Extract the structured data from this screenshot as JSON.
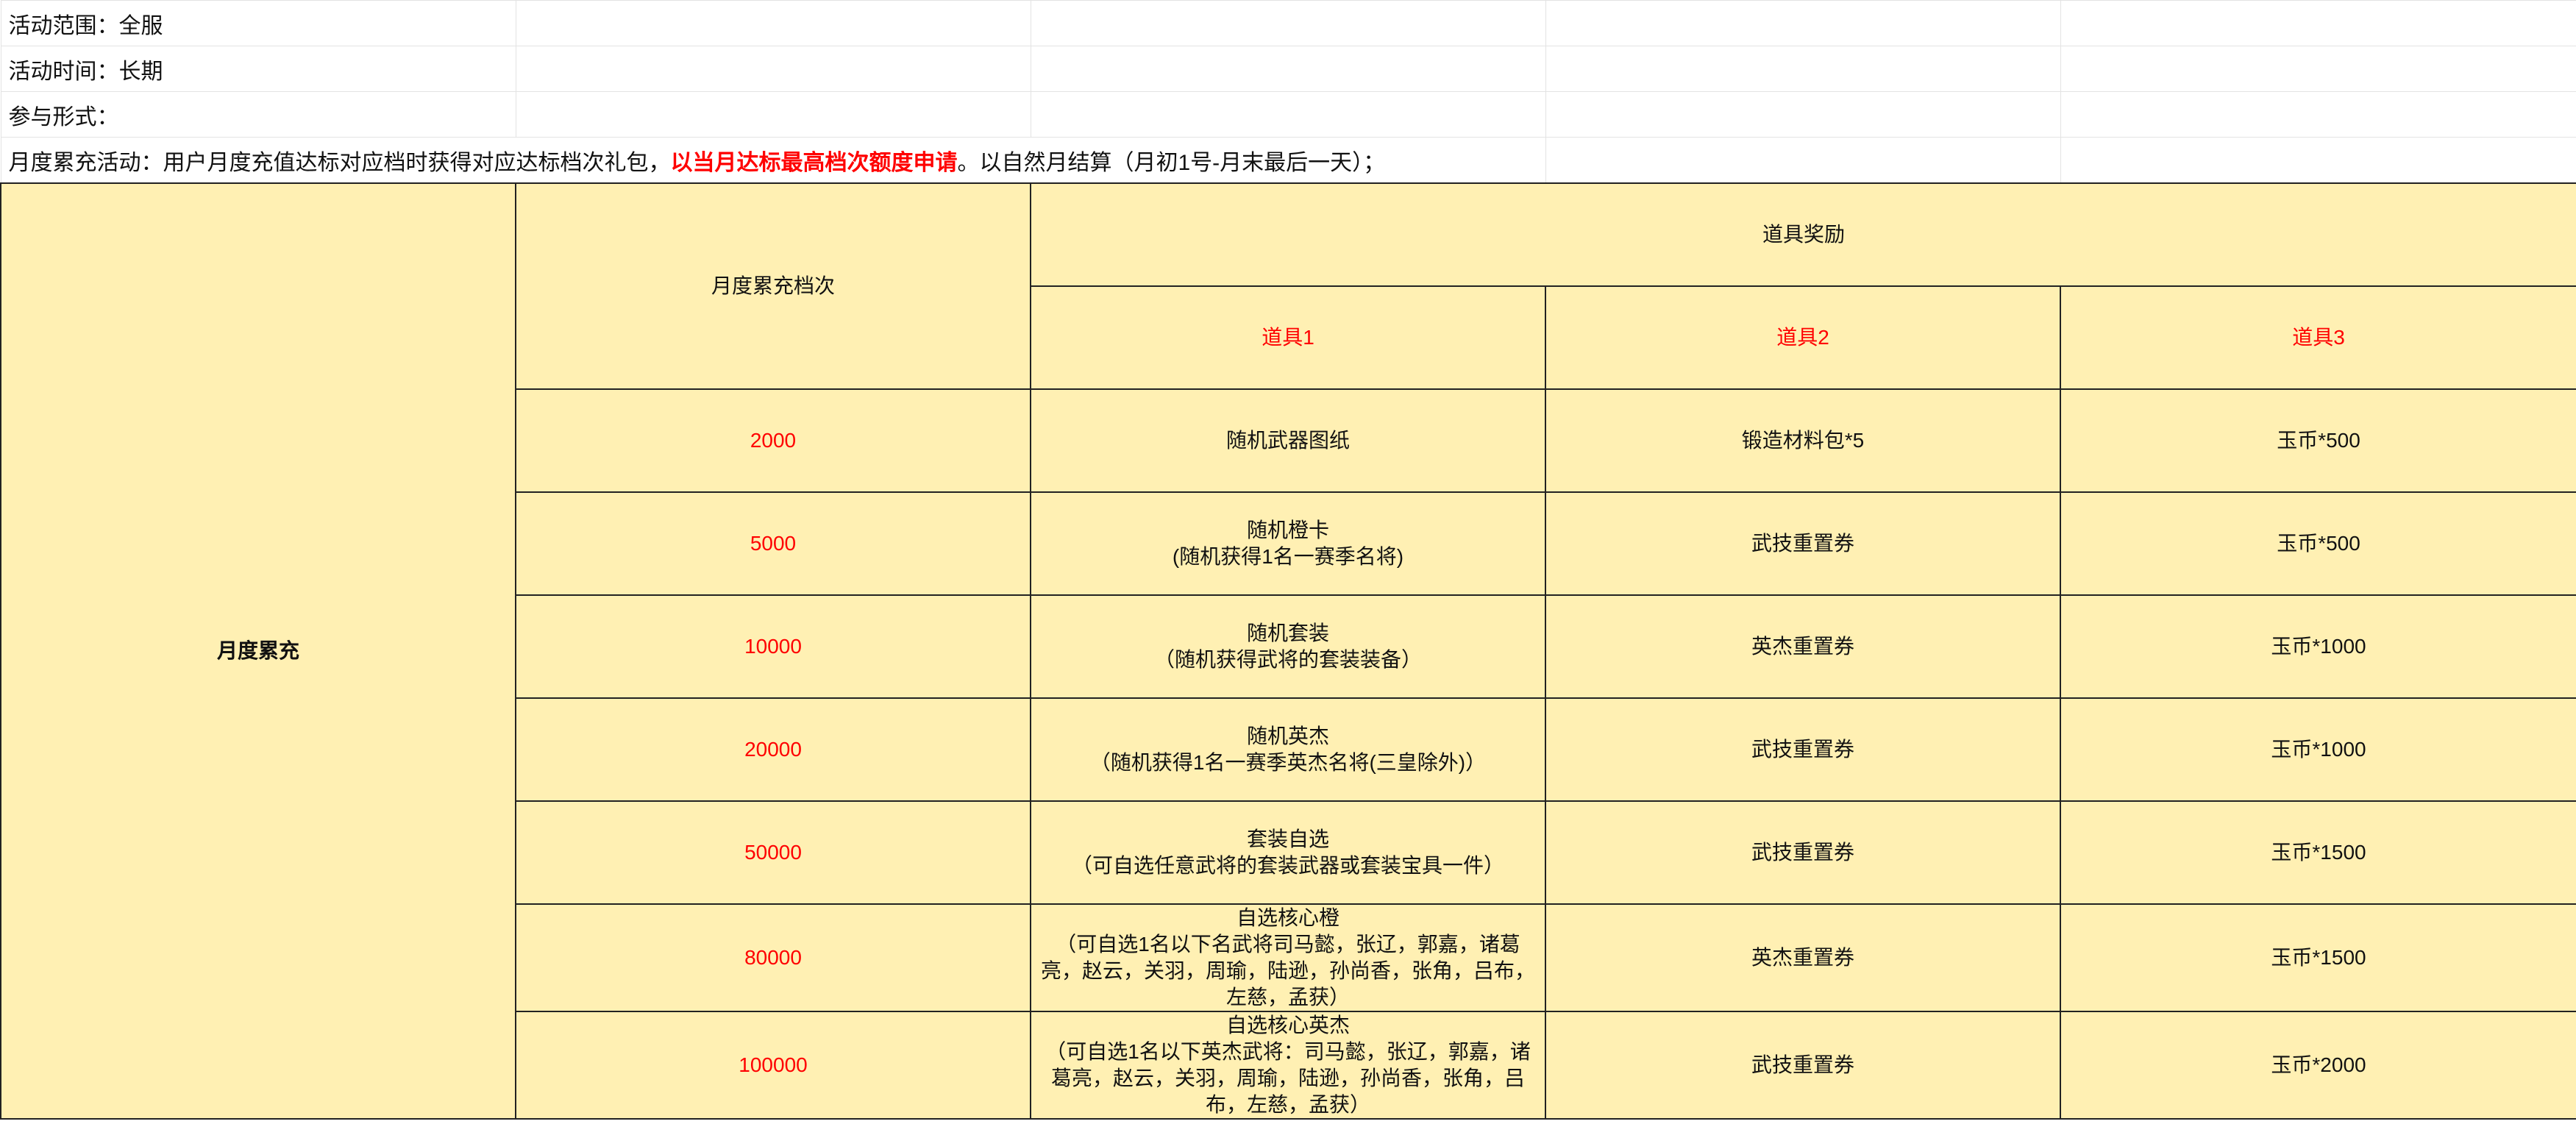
{
  "info": {
    "scope": "活动范围：全服",
    "time": "活动时间：长期",
    "form": "参与形式：",
    "desc_prefix": "月度累充活动：用户月度充值达标对应档时获得对应达标档次礼包，",
    "desc_highlight": "以当月达标最高档次额度申请",
    "desc_suffix": "。以自然月结算（月初1号-月末最后一天）；"
  },
  "table": {
    "section_title": "月度累充",
    "tier_header": "月度累充档次",
    "reward_header": "道具奖励",
    "item_headers": [
      "道具1",
      "道具2",
      "道具3"
    ],
    "rows": [
      {
        "tier": "2000",
        "item1_name": "随机武器图纸",
        "item1_desc": "",
        "item2": "锻造材料包*5",
        "item3": "玉币*500"
      },
      {
        "tier": "5000",
        "item1_name": "随机橙卡",
        "item1_desc": "(随机获得1名一赛季名将)",
        "item2": "武技重置券",
        "item3": "玉币*500"
      },
      {
        "tier": "10000",
        "item1_name": "随机套装",
        "item1_desc": "（随机获得武将的套装装备）",
        "item2": "英杰重置券",
        "item3": "玉币*1000"
      },
      {
        "tier": "20000",
        "item1_name": "随机英杰",
        "item1_desc": "（随机获得1名一赛季英杰名将(三皇除外)）",
        "item2": "武技重置券",
        "item3": "玉币*1000"
      },
      {
        "tier": "50000",
        "item1_name": "套装自选",
        "item1_desc": "（可自选任意武将的套装武器或套装宝具一件）",
        "item2": "武技重置券",
        "item3": "玉币*1500"
      },
      {
        "tier": "80000",
        "item1_name": "自选核心橙",
        "item1_desc": "（可自选1名以下名武将司马懿，张辽，郭嘉，诸葛亮，赵云，关羽，周瑜，陆逊，孙尚香，张角，吕布，左慈，孟获）",
        "item2": "英杰重置券",
        "item3": "玉币*1500"
      },
      {
        "tier": "100000",
        "item1_name": "自选核心英杰",
        "item1_desc": "（可自选1名以下英杰武将：司马懿，张辽，郭嘉，诸葛亮，赵云，关羽，周瑜，陆逊，孙尚香，张角，吕布，左慈，孟获）",
        "item2": "武技重置券",
        "item3": "玉币*2000"
      }
    ]
  }
}
